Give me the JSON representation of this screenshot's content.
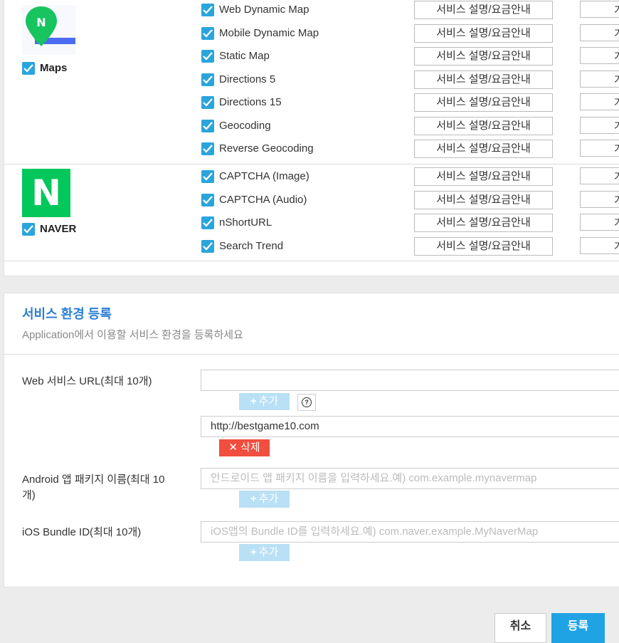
{
  "groups": [
    {
      "label": "Maps",
      "checked": true,
      "apis": [
        {
          "name": "Web Dynamic Map",
          "checked": true
        },
        {
          "name": "Mobile Dynamic Map",
          "checked": true
        },
        {
          "name": "Static Map",
          "checked": true
        },
        {
          "name": "Directions 5",
          "checked": true
        },
        {
          "name": "Directions 15",
          "checked": true
        },
        {
          "name": "Geocoding",
          "checked": true
        },
        {
          "name": "Reverse Geocoding",
          "checked": true
        }
      ]
    },
    {
      "label": "NAVER",
      "logo_letter": "N",
      "checked": true,
      "apis": [
        {
          "name": "CAPTCHA (Image)",
          "checked": true
        },
        {
          "name": "CAPTCHA (Audio)",
          "checked": true
        },
        {
          "name": "nShortURL",
          "checked": true
        },
        {
          "name": "Search Trend",
          "checked": true
        }
      ]
    }
  ],
  "service_info_label": "서비스 설명/요금안내",
  "extra_button_label": "가",
  "env": {
    "title": "서비스 환경 등록",
    "subtitle": "Application에서 이용할 서비스 환경을 등록하세요",
    "web": {
      "label": "Web 서비스 URL(최대 10개)",
      "value": "",
      "urls": [
        "http://bestgame10.com"
      ]
    },
    "android": {
      "label": "Android 앱 패키지 이름(최대 10 개)",
      "placeholder": "안드로이드 앱 패키지 이름을 입력하세요.예) com.example.mynavermap"
    },
    "ios": {
      "label": "iOS Bundle ID(최대 10개)",
      "placeholder": "iOS앱의 Bundle ID를 입력하세요.예) com.naver.example.MyNaverMap"
    },
    "add_label": "추가",
    "delete_label": "삭제",
    "help_symbol": "?"
  },
  "footer": {
    "cancel_label": "취소",
    "register_label": "등록"
  },
  "colors": {
    "accent": "#2aa5dc",
    "title": "#2b7fd4",
    "naver_green": "#03c75a",
    "delete_red": "#f04e3e",
    "add_disabled": "#b9e0f5",
    "primary_button": "#1fa3e4"
  },
  "icons": {
    "maps_logo": "map-pin-icon",
    "checkbox": "checkmark-icon",
    "add": "plus-icon",
    "delete": "close-icon",
    "help": "question-icon"
  }
}
